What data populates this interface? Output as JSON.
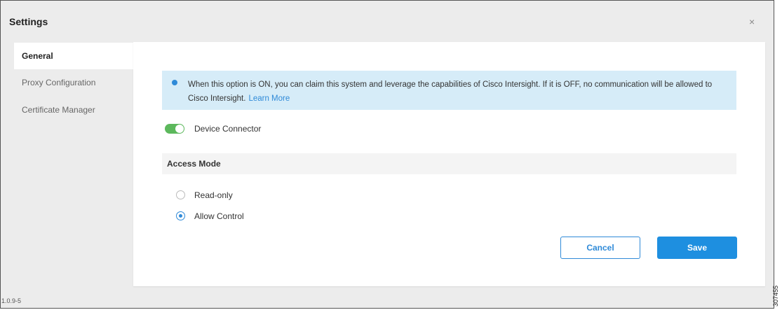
{
  "window": {
    "title": "Settings",
    "close_symbol": "×"
  },
  "sidebar": {
    "items": [
      {
        "label": "General",
        "active": true
      },
      {
        "label": "Proxy Configuration",
        "active": false
      },
      {
        "label": "Certificate Manager",
        "active": false
      }
    ]
  },
  "info": {
    "icon": "info-icon",
    "text": "When this option is ON, you can claim this system and leverage the capabilities of Cisco Intersight. If it is OFF, no communication will be allowed to Cisco Intersight.",
    "link_label": "Learn More"
  },
  "device_connector": {
    "label": "Device Connector",
    "enabled": true,
    "color": "#5cb85c"
  },
  "access_mode": {
    "header": "Access Mode",
    "options": [
      {
        "label": "Read-only",
        "selected": false
      },
      {
        "label": "Allow Control",
        "selected": true
      }
    ]
  },
  "actions": {
    "cancel_label": "Cancel",
    "save_label": "Save"
  },
  "footer": {
    "version": "1.0.9-5",
    "figure_id": "307455"
  },
  "colors": {
    "accent": "#2f8ad8",
    "info_background": "#d6ecf8",
    "save_button": "#1e8fe0"
  }
}
